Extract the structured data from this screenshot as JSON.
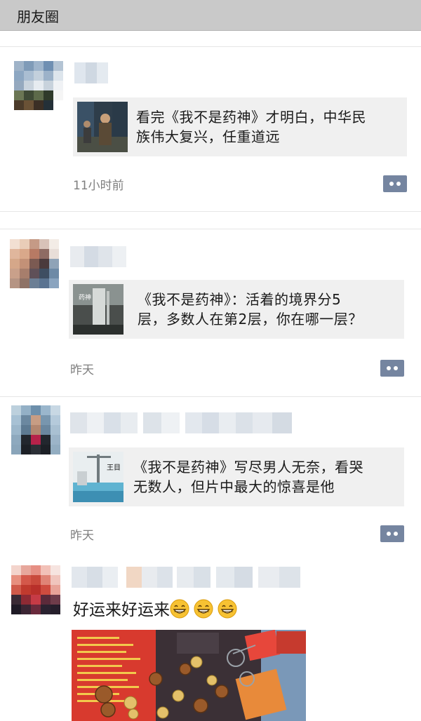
{
  "header": {
    "title": "朋友圈"
  },
  "posts": [
    {
      "share_text_line1": "看完《我不是药神》才明白，中华民",
      "share_text_line2": "族伟大复兴，任重道远",
      "time": "11小时前"
    },
    {
      "share_text_line1": "《我不是药神》：活着的境界分5",
      "share_text_line2": "层，多数人在第2层，你在哪一层？",
      "time": "昨天"
    },
    {
      "share_text_line1": "《我不是药神》写尽男人无奈，看哭",
      "share_text_line2": "无数人，但片中最大的惊喜是他",
      "time": "昨天"
    },
    {
      "moment_text": "好运来好运来"
    }
  ],
  "icons": {
    "comment": "comment-dots-icon",
    "emoji": "grinning-face-icon"
  },
  "colors": {
    "header_bg": "#c9c9c9",
    "card_bg": "#f0f0f0",
    "comment_button": "#7585a0",
    "timestamp": "#7f7f7f"
  }
}
